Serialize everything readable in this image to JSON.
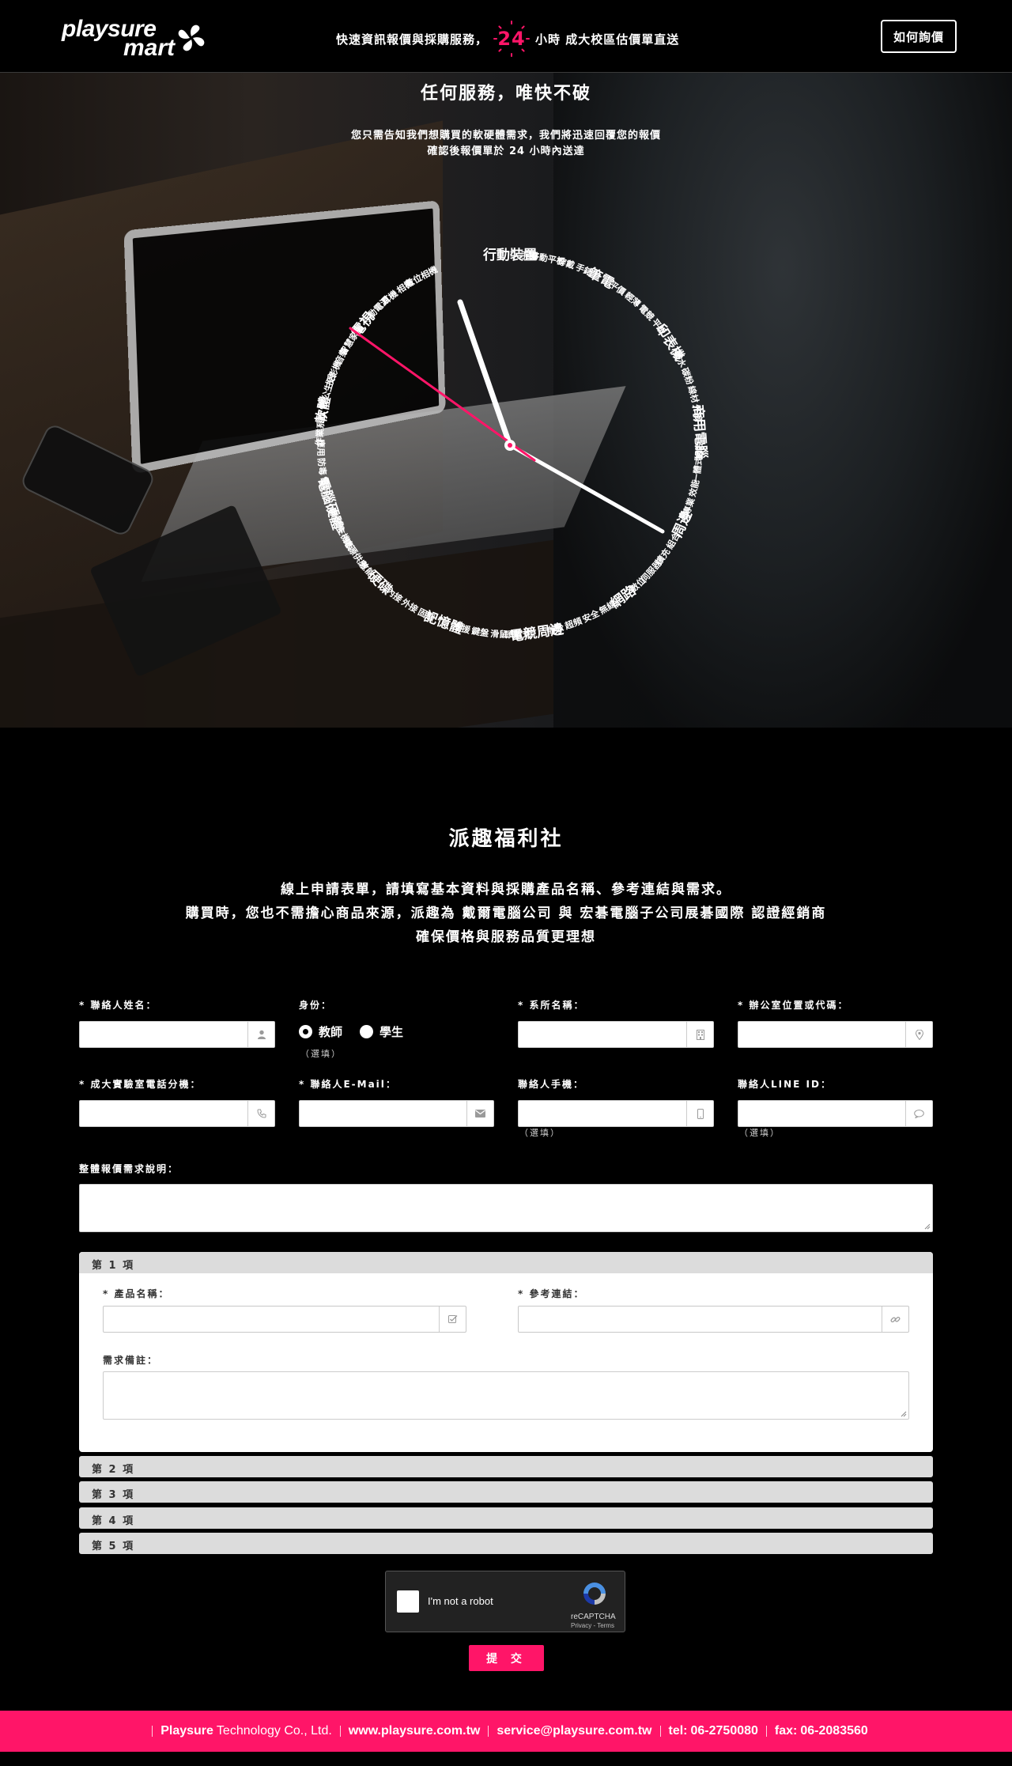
{
  "header": {
    "logo_line1": "playsure",
    "logo_line2": "mart",
    "tagline_before": "快速資訊報價與採購服務，",
    "tagline_number": "24",
    "tagline_after": "小時 成大校區估價單直送",
    "how_button": "如何詢價"
  },
  "hero": {
    "title": "任何服務，唯快不破",
    "subtitle_line1": "您只需告知我們想購買的軟硬體需求，我們將迅速回覆您的報價",
    "subtitle_line2": "確認後報價單於 24 小時內送達",
    "clock_categories": [
      {
        "label": "行動裝置",
        "major": true
      },
      {
        "label": "手機",
        "major": false
      },
      {
        "label": "移動平板",
        "major": false
      },
      {
        "label": "穿戴",
        "major": false
      },
      {
        "label": "手錶",
        "major": false
      },
      {
        "label": "筆電",
        "major": true
      },
      {
        "label": "平價",
        "major": false
      },
      {
        "label": "輕薄",
        "major": false
      },
      {
        "label": "電競",
        "major": false
      },
      {
        "label": "平板",
        "major": false
      },
      {
        "label": "印表機",
        "major": true
      },
      {
        "label": "墨水",
        "major": false
      },
      {
        "label": "碳粉",
        "major": false
      },
      {
        "label": "線材",
        "major": false
      },
      {
        "label": "外接",
        "major": false
      },
      {
        "label": "商用電腦",
        "major": true
      },
      {
        "label": "組合",
        "major": false
      },
      {
        "label": "一體式",
        "major": false
      },
      {
        "label": "效能",
        "major": false
      },
      {
        "label": "專業",
        "major": false
      },
      {
        "label": "周邊",
        "major": true
      },
      {
        "label": "組合",
        "major": false
      },
      {
        "label": "擴充",
        "major": false
      },
      {
        "label": "伺服器",
        "major": false
      },
      {
        "label": "數位",
        "major": false
      },
      {
        "label": "網路",
        "major": true
      },
      {
        "label": "無線",
        "major": false
      },
      {
        "label": "安全",
        "major": false
      },
      {
        "label": "超頻",
        "major": false
      },
      {
        "label": "辦公",
        "major": false
      },
      {
        "label": "電競周邊",
        "major": true
      },
      {
        "label": "頭戴式",
        "major": false
      },
      {
        "label": "滑鼠",
        "major": false
      },
      {
        "label": "鍵盤",
        "major": false
      },
      {
        "label": "支援",
        "major": false
      },
      {
        "label": "記憶體",
        "major": true
      },
      {
        "label": "固態",
        "major": false
      },
      {
        "label": "外接",
        "major": false
      },
      {
        "label": "內接",
        "major": false
      },
      {
        "label": "硬碟",
        "major": true
      },
      {
        "label": "效能",
        "major": false
      },
      {
        "label": "電源供應",
        "major": false
      },
      {
        "label": "主機板",
        "major": false
      },
      {
        "label": "顯示卡",
        "major": false
      },
      {
        "label": "電腦硬體",
        "major": true
      },
      {
        "label": "電玩",
        "major": false
      },
      {
        "label": "防毒",
        "major": false
      },
      {
        "label": "應用",
        "major": false
      },
      {
        "label": "作業系統",
        "major": false
      },
      {
        "label": "軟體",
        "major": true
      },
      {
        "label": "辦公生活",
        "major": false
      },
      {
        "label": "投影機",
        "major": false
      },
      {
        "label": "音樂",
        "major": false
      },
      {
        "label": "智慧家居",
        "major": false
      },
      {
        "label": "電視",
        "major": true
      },
      {
        "label": "行動電源",
        "major": false
      },
      {
        "label": "耳機",
        "major": false
      },
      {
        "label": "相機",
        "major": false
      },
      {
        "label": "數位相機",
        "major": false
      }
    ]
  },
  "intro": {
    "title": "派趣福利社",
    "line1": "線上申請表單，請填寫基本資料與採購產品名稱、參考連結與需求。",
    "line2": "購買時，您也不需擔心商品來源，派趣為 戴爾電腦公司 與 宏碁電腦子公司展碁國際 認證經銷商",
    "line3": "確保價格與服務品質更理想"
  },
  "form": {
    "contact_name_label": "* 聯絡人姓名：",
    "identity_label": "身份：",
    "identity_options": [
      "教師",
      "學生"
    ],
    "identity_selected": "教師",
    "optional_note": "（選填）",
    "department_label": "* 系所名稱：",
    "office_label": "* 辦公室位置或代碼：",
    "lab_phone_label": "* 成大實驗室電話分機：",
    "email_label": "* 聯絡人E-Mail：",
    "mobile_label": "聯絡人手機：",
    "line_label": "聯絡人LINE ID：",
    "overall_label": "整體報價需求說明：",
    "contact_name_value": "",
    "department_value": "",
    "office_value": "",
    "lab_phone_value": "",
    "email_value": "",
    "mobile_value": "",
    "line_value": ""
  },
  "items": {
    "item1_header": "第 1 項",
    "product_label": "* 產品名稱：",
    "reference_label": "* 參考連結：",
    "remarks_label": "需求備註：",
    "collapsed": [
      "第 2 項",
      "第 3 項",
      "第 4 項",
      "第 5 項"
    ]
  },
  "captcha": {
    "text": "I'm not a robot",
    "brand": "reCAPTCHA",
    "links": "Privacy - Terms"
  },
  "submit_label": "提 交",
  "footer": {
    "company_bold": "Playsure",
    "company_rest": "Technology Co., Ltd.",
    "website": "www.playsure.com.tw",
    "email": "service@playsure.com.tw",
    "tel_label": "tel:",
    "tel": "06-2750080",
    "fax_label": "fax:",
    "fax": "06-2083560"
  },
  "colors": {
    "accent": "#ff1568",
    "background": "#000000"
  }
}
